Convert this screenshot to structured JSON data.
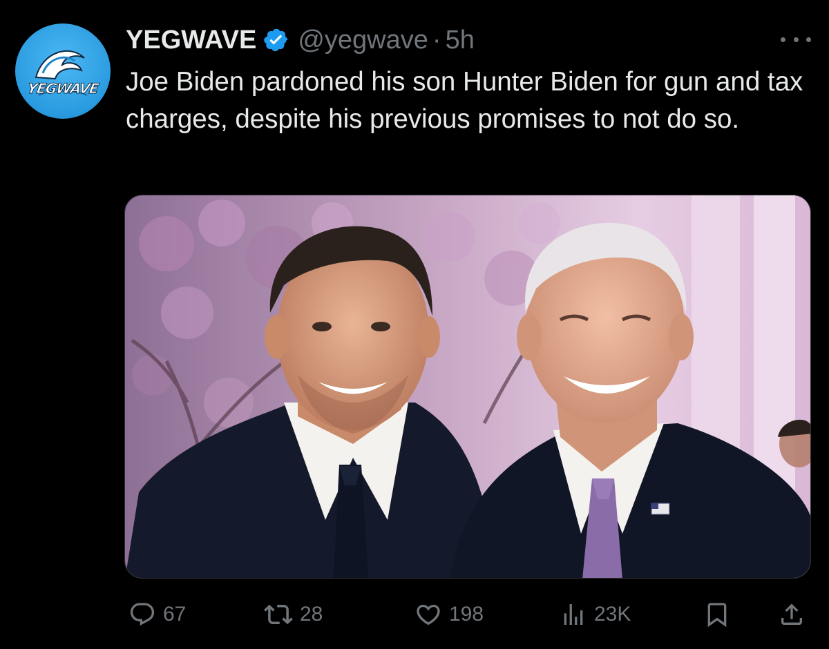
{
  "author": {
    "avatar_text": "YEGWAVE",
    "display_name": "YEGWAVE",
    "handle": "@yegwave",
    "separator": "·",
    "time": "5h",
    "verified": true
  },
  "tweet": {
    "text": "Joe Biden pardoned his son Hunter Biden for gun and tax charges, despite his previous promises to not do so."
  },
  "media": {
    "type": "photo",
    "scene": "two men in dark suits smiling in front of pink blossoms"
  },
  "actions": {
    "replies": "67",
    "reposts": "28",
    "likes": "198",
    "views": "23K"
  },
  "colors": {
    "background": "#000000",
    "text_primary": "#e7e9ea",
    "text_secondary": "#71767b",
    "verified_blue": "#1d9bf0",
    "avatar_blue": "#2a9be0"
  },
  "icons": [
    "reply-icon",
    "repost-icon",
    "like-icon",
    "views-icon",
    "bookmark-icon",
    "share-icon",
    "more-icon",
    "verified-badge-icon"
  ]
}
